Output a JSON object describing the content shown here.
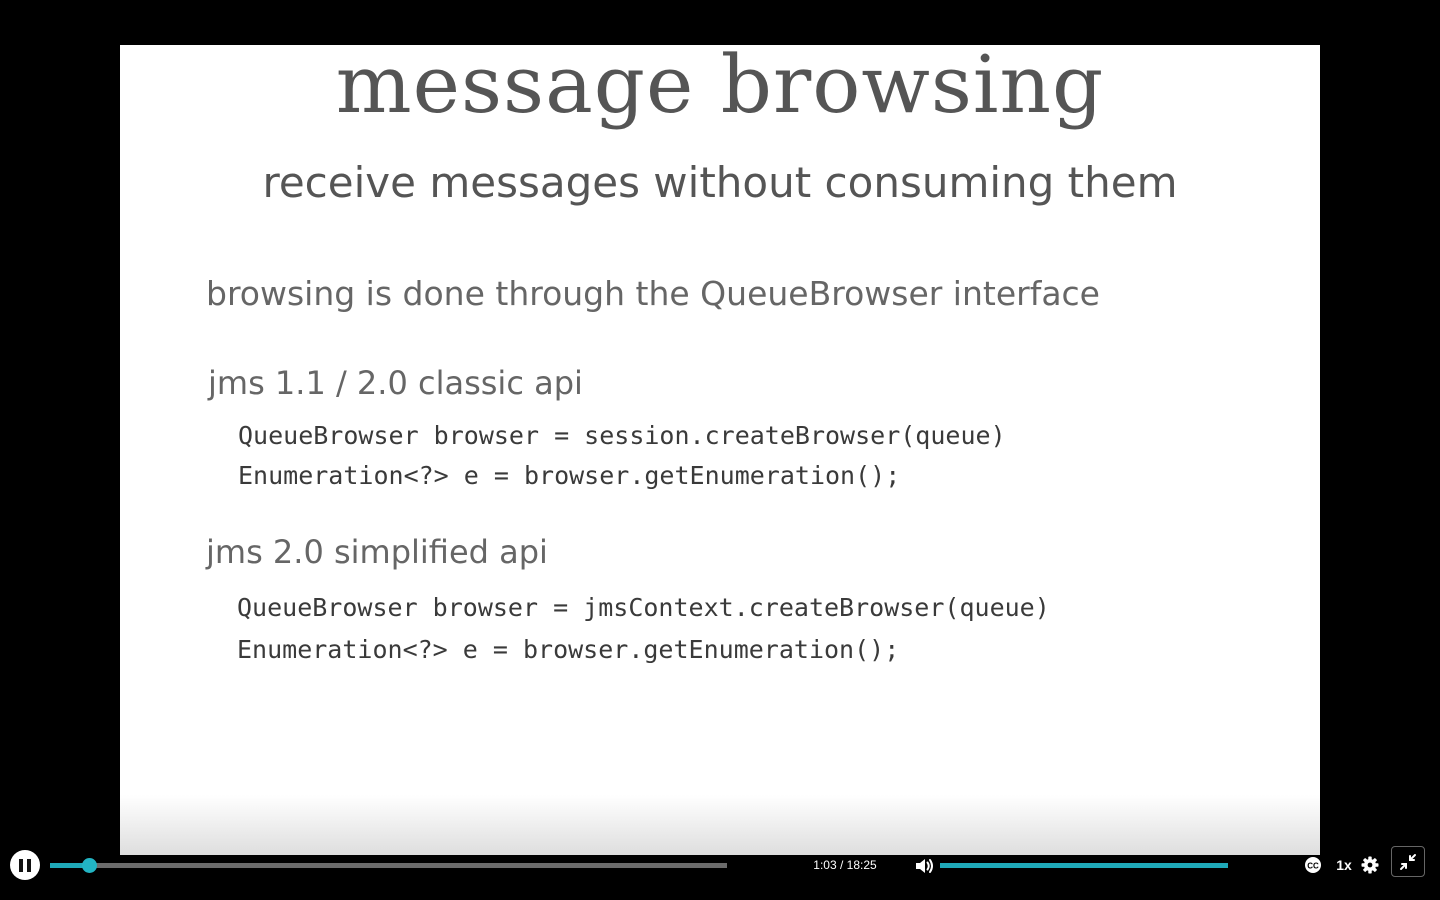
{
  "slide": {
    "title": "message browsing",
    "subtitle": "receive messages without consuming them",
    "lead": "browsing is done through the QueueBrowser interface",
    "sections": [
      {
        "heading": "jms 1.1 / 2.0 classic api",
        "code": [
          "QueueBrowser browser = session.createBrowser(queue)",
          "Enumeration<?> e = browser.getEnumeration();"
        ]
      },
      {
        "heading": "jms 2.0 simplified api",
        "code": [
          "QueueBrowser browser = jmsContext.createBrowser(queue)",
          "Enumeration<?> e = browser.getEnumeration();"
        ]
      }
    ]
  },
  "player": {
    "state_icon": "pause-icon",
    "current_time": "1:03",
    "duration": "18:25",
    "time_text": "1:03 / 18:25",
    "progress_fraction": 0.057,
    "volume_fraction": 1.0,
    "speed_label": "1x",
    "icons": {
      "volume": "volume-icon",
      "captions": "closed-captions-icon",
      "settings": "gear-icon",
      "fullscreen": "exit-fullscreen-icon"
    },
    "accent_color": "#1fa9b8"
  }
}
